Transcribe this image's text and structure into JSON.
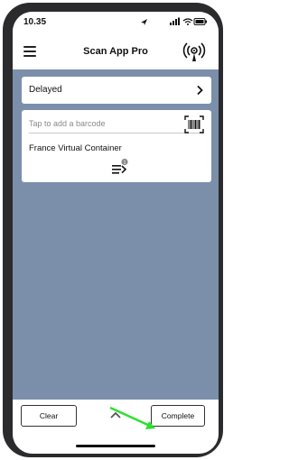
{
  "status_bar": {
    "time": "10.35",
    "icons": [
      "location-arrow-icon",
      "signal-icon",
      "wifi-icon",
      "battery-icon"
    ]
  },
  "header": {
    "title": "Scan App Pro",
    "left_icon": "hamburger-menu-icon",
    "right_icon": "radar-scan-icon"
  },
  "status_selector": {
    "value": "Delayed",
    "icon": "chevron-right-icon"
  },
  "scan_card": {
    "barcode_placeholder": "Tap to add a barcode",
    "barcode_icon": "barcode-scanner-icon",
    "container_name": "France Virtual Container",
    "list_icon": "list-icon",
    "list_badge": "1"
  },
  "footer": {
    "clear_label": "Clear",
    "complete_label": "Complete",
    "expand_icon": "chevron-up-icon"
  },
  "colors": {
    "background": "#7b8fab",
    "surface": "#ffffff",
    "phone_frame": "#2b2b2d",
    "annotation_arrow": "#2ee02e"
  }
}
